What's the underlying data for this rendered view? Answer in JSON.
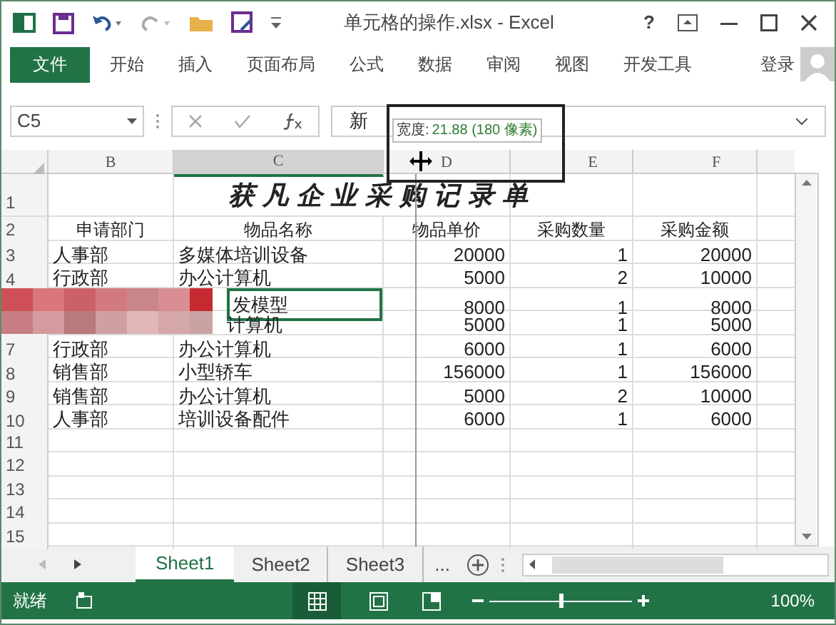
{
  "window": {
    "title": "单元格的操作.xlsx - Excel",
    "help": "?"
  },
  "ribbon_tabs": [
    {
      "label": "文件",
      "kind": "file"
    },
    {
      "label": "开始",
      "kind": "tab"
    },
    {
      "label": "插入",
      "kind": "tab"
    },
    {
      "label": "页面布局",
      "kind": "tab"
    },
    {
      "label": "公式",
      "kind": "tab"
    },
    {
      "label": "数据",
      "kind": "tab"
    },
    {
      "label": "审阅",
      "kind": "tab"
    },
    {
      "label": "视图",
      "kind": "tab"
    },
    {
      "label": "开发工具",
      "kind": "tab"
    }
  ],
  "account": {
    "label": "登录"
  },
  "formula_bar": {
    "name_box": "C5",
    "formula": "新"
  },
  "tooltip": {
    "label": "宽度:",
    "value": "21.88 (180 像素)"
  },
  "sheet": {
    "columns": [
      "B",
      "C",
      "D",
      "E",
      "F"
    ],
    "title": "获凡企业采购记录单",
    "header": [
      "申请部门",
      "物品名称",
      "物品单价",
      "采购数量",
      "采购金额"
    ],
    "rows": [
      {
        "row": "3",
        "b": "人事部",
        "c": "多媒体培训设备",
        "d": "20000",
        "e": "1",
        "f": "20000",
        "selected": false,
        "redacted": false
      },
      {
        "row": "4",
        "b": "行政部",
        "c": "办公计算机",
        "d": "5000",
        "e": "2",
        "f": "10000",
        "selected": false,
        "redacted": false
      },
      {
        "c": "发模型",
        "d": "8000",
        "e": "1",
        "f": "8000",
        "selected": true,
        "redacted": true
      },
      {
        "c": "计算机",
        "d": "5000",
        "e": "1",
        "f": "5000",
        "selected": false,
        "redacted": true
      },
      {
        "row": "7",
        "b": "行政部",
        "c": "办公计算机",
        "d": "6000",
        "e": "1",
        "f": "6000",
        "selected": false,
        "redacted": false
      },
      {
        "row": "8",
        "b": "销售部",
        "c": "小型轿车",
        "d": "156000",
        "e": "1",
        "f": "156000",
        "selected": false,
        "redacted": false
      },
      {
        "row": "9",
        "b": "销售部",
        "c": "办公计算机",
        "d": "5000",
        "e": "2",
        "f": "10000",
        "selected": false,
        "redacted": false
      },
      {
        "row": "10",
        "b": "人事部",
        "c": "培训设备配件",
        "d": "6000",
        "e": "1",
        "f": "6000",
        "selected": false,
        "redacted": false
      }
    ],
    "title_row": "1",
    "header_row": "2",
    "empty_rows": [
      "11",
      "12",
      "13",
      "14",
      "15"
    ]
  },
  "sheet_tabs": [
    {
      "label": "Sheet1",
      "selected": true
    },
    {
      "label": "Sheet2",
      "selected": false
    },
    {
      "label": "Sheet3",
      "selected": false
    }
  ],
  "more_sheets": "...",
  "status_bar": {
    "status": "就绪",
    "zoom": "100%",
    "zoom_level": {
      "level": 0.5
    }
  }
}
